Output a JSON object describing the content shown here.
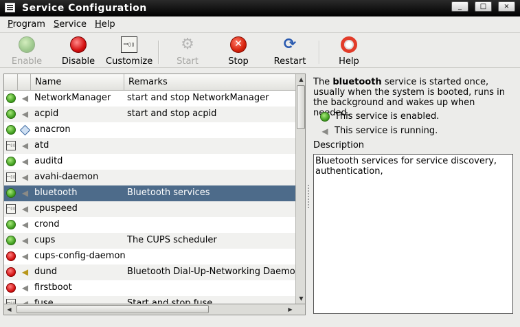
{
  "window": {
    "title": "Service Configuration",
    "controls": [
      "_",
      "□",
      "×"
    ]
  },
  "menubar": {
    "items": [
      {
        "label": "Program",
        "mnemonic": "P",
        "rest": "rogram"
      },
      {
        "label": "Service",
        "mnemonic": "S",
        "rest": "ervice"
      },
      {
        "label": "Help",
        "mnemonic": "H",
        "rest": "elp"
      }
    ]
  },
  "toolbar": {
    "enable": {
      "label": "Enable",
      "icon": "green-dot-icon",
      "enabled": false
    },
    "disable": {
      "label": "Disable",
      "icon": "red-dot-icon",
      "enabled": true
    },
    "customize": {
      "label": "Customize",
      "icon": "customize-icon",
      "glyph": "ꟷ▯▯",
      "enabled": true
    },
    "start": {
      "label": "Start",
      "icon": "gears-icon",
      "glyph": "⚙",
      "enabled": false
    },
    "stop": {
      "label": "Stop",
      "icon": "stop-icon",
      "glyph": "✕",
      "enabled": true
    },
    "restart": {
      "label": "Restart",
      "icon": "refresh-icon",
      "glyph": "⟳",
      "enabled": true
    },
    "help": {
      "label": "Help",
      "icon": "lifebuoy-icon",
      "enabled": true
    }
  },
  "list": {
    "columns": {
      "name": "Name",
      "remarks": "Remarks"
    },
    "rows": [
      {
        "name": "NetworkManager",
        "remark": "start and stop NetworkManager",
        "state": "enabled",
        "run": "plug"
      },
      {
        "name": "acpid",
        "remark": "start and stop acpid",
        "state": "enabled",
        "run": "plug"
      },
      {
        "name": "anacron",
        "remark": "",
        "state": "enabled",
        "run": "diamond"
      },
      {
        "name": "atd",
        "remark": "",
        "state": "custom",
        "run": "plug"
      },
      {
        "name": "auditd",
        "remark": "",
        "state": "enabled",
        "run": "plug"
      },
      {
        "name": "avahi-daemon",
        "remark": "",
        "state": "custom",
        "run": "plug"
      },
      {
        "name": "bluetooth",
        "remark": "Bluetooth services",
        "state": "enabled",
        "run": "plug",
        "selected": true
      },
      {
        "name": "cpuspeed",
        "remark": "",
        "state": "custom",
        "run": "plug"
      },
      {
        "name": "crond",
        "remark": "",
        "state": "enabled",
        "run": "plug"
      },
      {
        "name": "cups",
        "remark": "The CUPS scheduler",
        "state": "enabled",
        "run": "plug"
      },
      {
        "name": "cups-config-daemon",
        "remark": "",
        "state": "disabled",
        "run": "plug"
      },
      {
        "name": "dund",
        "remark": "Bluetooth Dial-Up-Networking Daemon.",
        "state": "disabled",
        "run": "plug-yellow"
      },
      {
        "name": "firstboot",
        "remark": "",
        "state": "disabled",
        "run": "plug"
      },
      {
        "name": "fuse",
        "remark": "Start and stop fuse",
        "state": "custom",
        "run": "plug"
      }
    ],
    "custom_glyph": "ꟷ▯▯",
    "plug_glyph": "◀"
  },
  "info": {
    "prefix": "The ",
    "service": "bluetooth",
    "suffix": " service is started once, usually when the system is booted, runs in the background and wakes up when needed.",
    "enabled_text": "This service is enabled.",
    "running_text": "This service is running.",
    "description_label": "Description",
    "description": "Bluetooth services for service discovery, authentication,"
  },
  "colors": {
    "selection": "#4d6b8a",
    "titlebar": "#000000"
  }
}
